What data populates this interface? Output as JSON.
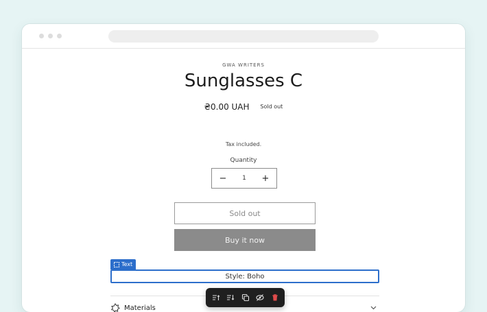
{
  "product": {
    "vendor": "GWA WRITERS",
    "title": "Sunglasses C",
    "price": "₴0.00 UAH",
    "badge": "Sold out",
    "tax_note": "Tax included."
  },
  "quantity": {
    "label": "Quantity",
    "value": "1",
    "decrement": "−",
    "increment": "+"
  },
  "buttons": {
    "sold_out": "Sold out",
    "buy_now": "Buy it now"
  },
  "editor": {
    "selected_block_type": "Text",
    "text_block_value": "Style: Boho",
    "selection_color": "#2c6ecb"
  },
  "collapsible": {
    "materials_label": "Materials"
  },
  "toolbar": {
    "icons": [
      "move-up-icon",
      "move-down-icon",
      "duplicate-icon",
      "hide-icon",
      "delete-icon"
    ]
  }
}
